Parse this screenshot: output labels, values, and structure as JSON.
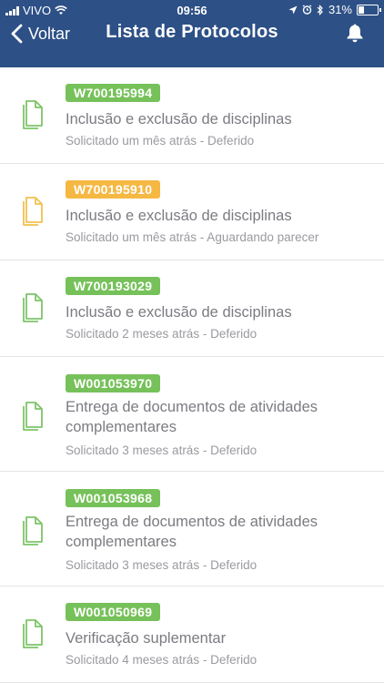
{
  "status_bar": {
    "carrier": "VIVO",
    "time": "09:56",
    "battery_percent": "31%",
    "battery_level": 0.31
  },
  "nav": {
    "back_label": "Voltar",
    "title": "Lista de Protocolos",
    "bell_icon": "bell-icon"
  },
  "colors": {
    "header_bg": "#2d5086",
    "badge_green": "#76c15a",
    "badge_orange": "#f5b843",
    "icon_green": "#7fc46a",
    "icon_orange": "#f2c14e"
  },
  "items": [
    {
      "code": "W700195994",
      "title": "Inclusão e exclusão de disciplinas",
      "subtitle": "Solicitado um mês atrás - Deferido",
      "status": "green"
    },
    {
      "code": "W700195910",
      "title": "Inclusão e exclusão de disciplinas",
      "subtitle": "Solicitado um mês atrás - Aguardando parecer",
      "status": "orange"
    },
    {
      "code": "W700193029",
      "title": "Inclusão e exclusão de disciplinas",
      "subtitle": "Solicitado 2 meses atrás - Deferido",
      "status": "green"
    },
    {
      "code": "W001053970",
      "title": "Entrega de documentos de atividades complementares",
      "subtitle": "Solicitado 3 meses atrás - Deferido",
      "status": "green"
    },
    {
      "code": "W001053968",
      "title": "Entrega de documentos de atividades complementares",
      "subtitle": "Solicitado 3 meses atrás - Deferido",
      "status": "green"
    },
    {
      "code": "W001050969",
      "title": "Verificação suplementar",
      "subtitle": "Solicitado 4 meses atrás - Deferido",
      "status": "green"
    }
  ]
}
